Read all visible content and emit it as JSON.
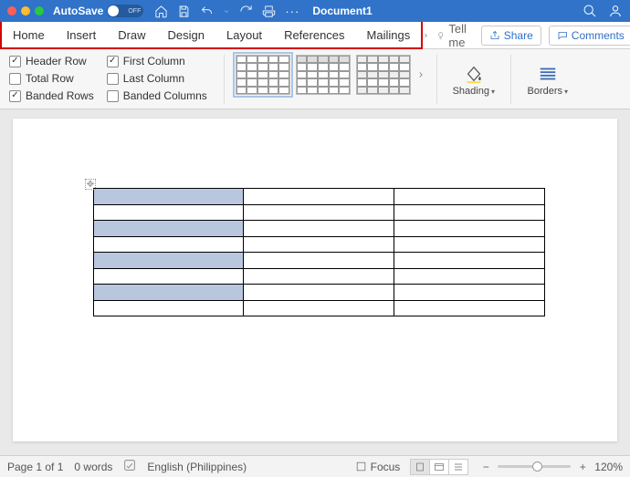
{
  "titlebar": {
    "autosave_label": "AutoSave",
    "autosave_state": "OFF",
    "doc_title": "Document1"
  },
  "tabs": [
    "Home",
    "Insert",
    "Draw",
    "Design",
    "Layout",
    "References",
    "Mailings"
  ],
  "tellme": "Tell me",
  "share": "Share",
  "comments": "Comments",
  "table_style_options": {
    "header_row": {
      "label": "Header Row",
      "checked": true
    },
    "total_row": {
      "label": "Total Row",
      "checked": false
    },
    "banded_rows": {
      "label": "Banded Rows",
      "checked": true
    },
    "first_column": {
      "label": "First Column",
      "checked": true
    },
    "last_column": {
      "label": "Last Column",
      "checked": false
    },
    "banded_columns": {
      "label": "Banded Columns",
      "checked": false
    }
  },
  "ribbon": {
    "shading": "Shading",
    "borders": "Borders"
  },
  "document_table": {
    "rows": 8,
    "cols": 3,
    "banded_first_column": true
  },
  "statusbar": {
    "page": "Page 1 of 1",
    "words": "0 words",
    "language": "English (Philippines)",
    "focus": "Focus",
    "zoom": "120%"
  }
}
